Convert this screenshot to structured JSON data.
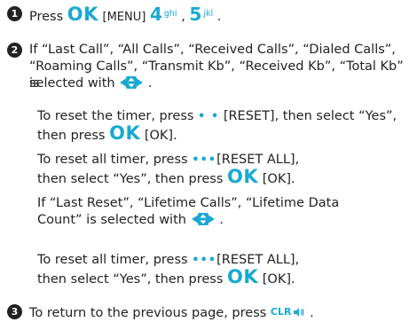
{
  "steps": [
    {
      "number": "1",
      "text": {
        "press": "Press",
        "ok_key": "OK",
        "menu_label": "[MENU]",
        "key1_num": "4",
        "key1_sub": "ghi",
        "comma": ",",
        "key2_num": "5",
        "key2_sub": "jkl",
        "end": "."
      }
    },
    {
      "number": "2",
      "line1": "If “Last Call”, “All Calls”, “Received Calls”, “Dialed Calls”,",
      "line2": "“Roaming Calls”, “Transmit Kb”, “Received Kb”, “Total Kb” is",
      "line3": "selected with",
      "line3_end": "."
    },
    {
      "number": "3",
      "text": "To return to the previous page, press",
      "clr_key": "CLR",
      "end": "."
    }
  ],
  "sub_blocks": {
    "reset_timer": {
      "l1_a": "To reset the timer, press",
      "l1_key": "• •",
      "l1_b": "[RESET], then select “Yes”,",
      "l2_a": "then press",
      "l2_ok": "OK",
      "l2_b": "[OK]."
    },
    "reset_all_1": {
      "l1_a": "To reset all timer, press",
      "l1_key": "•••",
      "l1_b": "[RESET ALL],",
      "l2_a": "then select “Yes”, then press",
      "l2_ok": "OK",
      "l2_b": "[OK]."
    },
    "lifetime": {
      "l1": "If “Last Reset”, “Lifetime Calls”, “Lifetime Data",
      "l2": "Count” is selected with",
      "l2_end": "."
    },
    "reset_all_2": {
      "l1_a": "To reset all timer, press",
      "l1_key": "•••",
      "l1_b": "[RESET ALL],",
      "l2_a": "then select “Yes”, then press",
      "l2_ok": "OK",
      "l2_b": "[OK]."
    }
  },
  "icons": {
    "nav_key": "up-down-navigation-key-icon",
    "speaker": "speaker-icon",
    "accent_color": "#19a9d2"
  }
}
